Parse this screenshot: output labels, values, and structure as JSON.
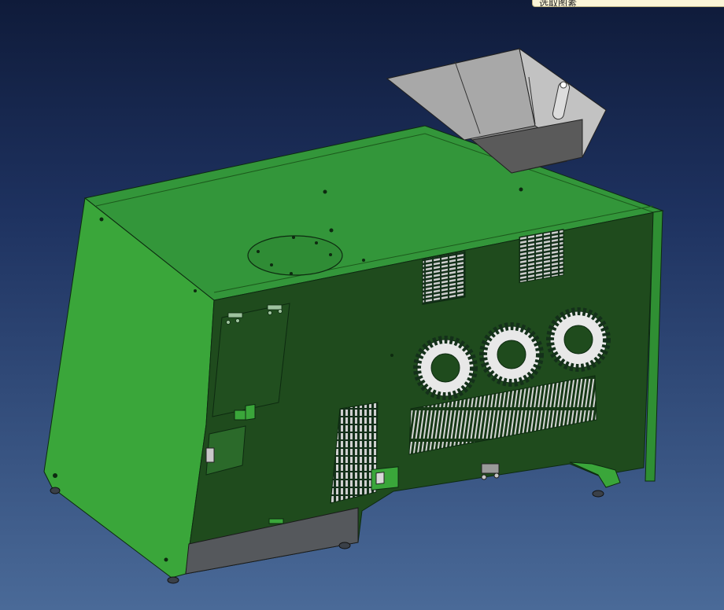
{
  "tooltip": {
    "text": "选取图素"
  },
  "viewport": {
    "model": "machine-enclosure",
    "colors": {
      "background_top": "#0f1b3a",
      "background_bottom": "#4a6a98",
      "body_light": "#3aa63a",
      "body_dark": "#1e4a1c",
      "hopper": "#9a9a9a",
      "panel": "#55585c"
    }
  }
}
